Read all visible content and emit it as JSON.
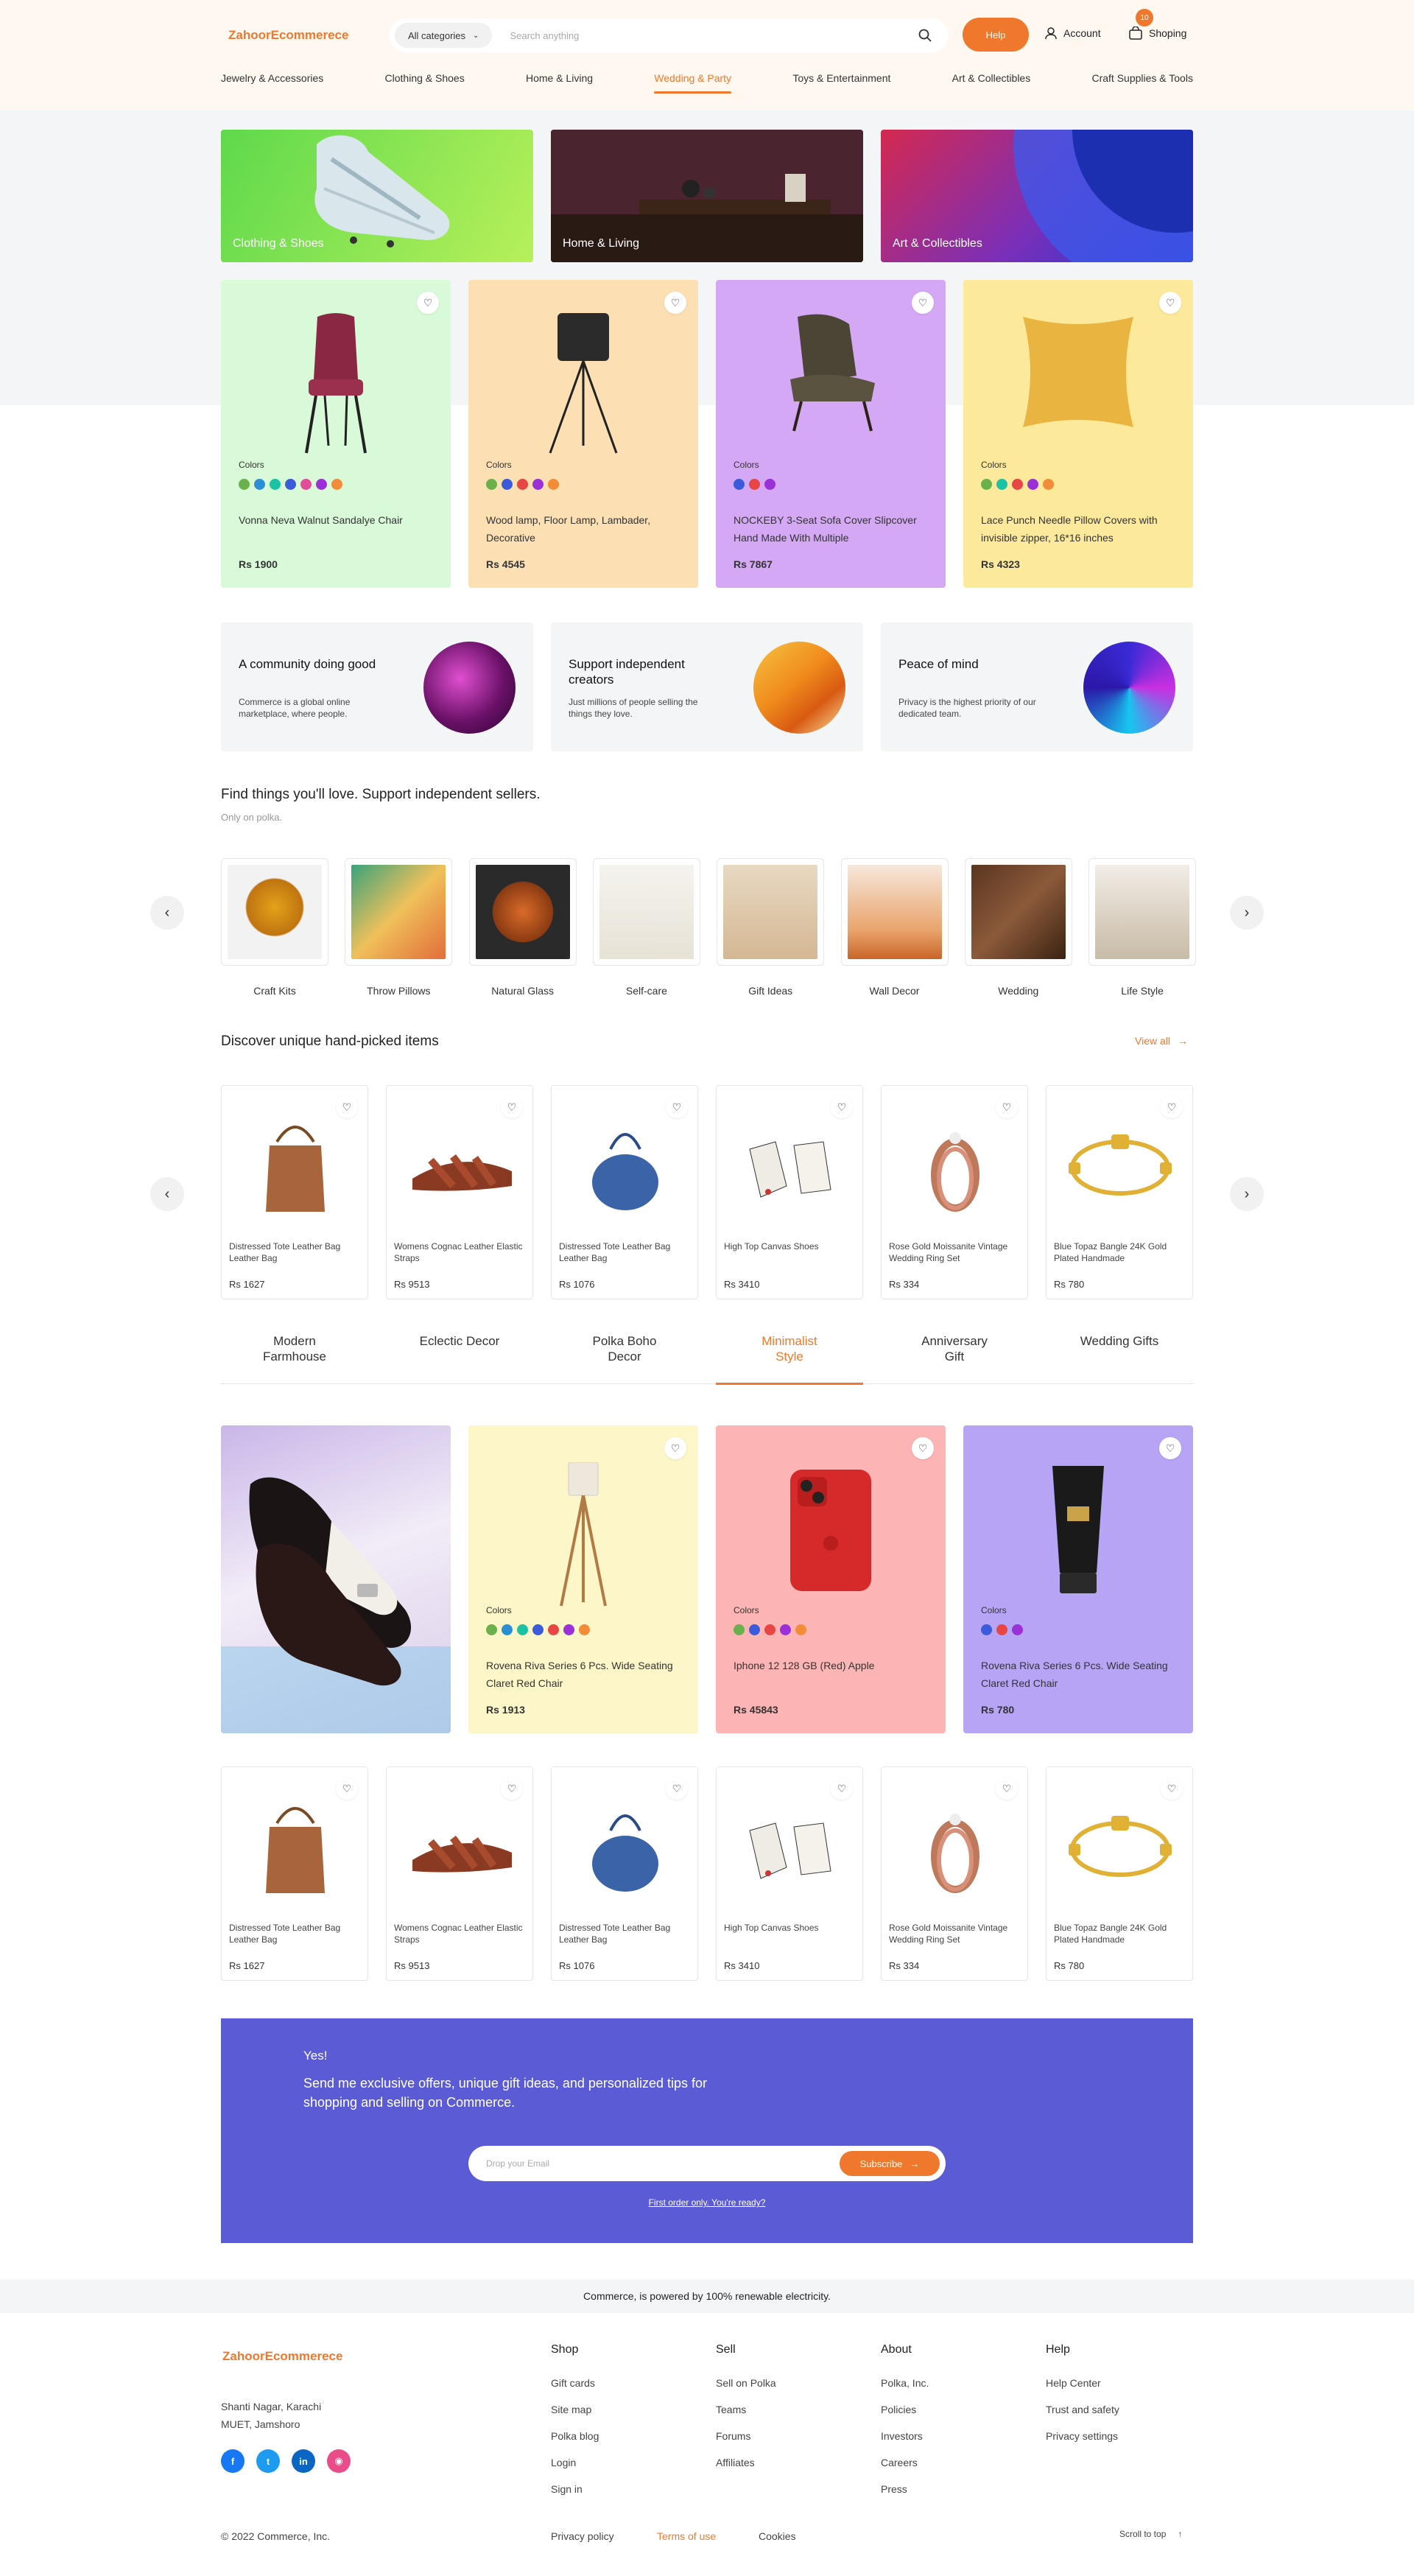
{
  "header": {
    "logo": "ZahoorEcommerece",
    "category_select": "All categories",
    "search_placeholder": "Search anything",
    "help": "Help",
    "account": "Account",
    "cart": "Shoping",
    "cart_count": "10"
  },
  "nav": [
    "Jewelry & Accessories",
    "Clothing & Shoes",
    "Home & Living",
    "Wedding & Party",
    "Toys & Entertainment",
    "Art & Collectibles",
    "Craft Supplies & Tools"
  ],
  "nav_active": "Wedding & Party",
  "banners": [
    "Clothing & Shoes",
    "Home & Living",
    "Art & Collectibles"
  ],
  "featured": {
    "colors_label": "Colors",
    "items": [
      {
        "name": "Vonna Neva Walnut Sandalye Chair",
        "price": "Rs 1900",
        "bg": "#d8fad8",
        "colors": [
          "#6ab04c",
          "#2c8fd6",
          "#1bc2a3",
          "#3b5bdb",
          "#e04e9a",
          "#9b30d9",
          "#f28c38"
        ]
      },
      {
        "name": "Wood lamp, Floor Lamp, Lambader, Decorative",
        "price": "Rs 4545",
        "bg": "#fddfb4",
        "colors": [
          "#6ab04c",
          "#3b5bdb",
          "#e84545",
          "#9b30d9",
          "#f28c38"
        ]
      },
      {
        "name": "NOCKEBY 3-Seat Sofa Cover Slipcover Hand Made With Multiple",
        "price": "Rs 7867",
        "bg": "#d4a8f5",
        "colors": [
          "#3b5bdb",
          "#e84545",
          "#9b30d9"
        ]
      },
      {
        "name": "Lace Punch Needle Pillow Covers with invisible zipper, 16*16 inches",
        "price": "Rs 4323",
        "bg": "#fde99b",
        "colors": [
          "#6ab04c",
          "#1bc2a3",
          "#e84545",
          "#9b30d9",
          "#f28c38"
        ]
      }
    ]
  },
  "info_cards": [
    {
      "title": "A community doing good",
      "desc": "Commerce is a global online marketplace, where people."
    },
    {
      "title": "Support independent creators",
      "desc": "Just millions of people selling the things they love."
    },
    {
      "title": "Peace of mind",
      "desc": "Privacy is the highest priority of our dedicated team."
    }
  ],
  "categories_section": {
    "title": "Find things you'll love. Support independent sellers.",
    "subtitle": "Only on polka.",
    "items": [
      "Craft Kits",
      "Throw Pillows",
      "Natural Glass",
      "Self-care",
      "Gift Ideas",
      "Wall Decor",
      "Wedding",
      "Life Style"
    ]
  },
  "handpicked": {
    "title": "Discover unique hand-picked items",
    "view_all": "View all",
    "items": [
      {
        "name": "Distressed Tote Leather Bag Leather Bag",
        "price": "Rs 1627"
      },
      {
        "name": "Womens Cognac Leather Elastic Straps",
        "price": "Rs 9513"
      },
      {
        "name": "Distressed Tote Leather Bag Leather Bag",
        "price": "Rs 1076"
      },
      {
        "name": "High Top Canvas Shoes",
        "price": "Rs 3410"
      },
      {
        "name": "Rose Gold Moissanite Vintage Wedding Ring Set",
        "price": "Rs 334"
      },
      {
        "name": "Blue Topaz Bangle 24K Gold Plated Handmade",
        "price": "Rs 780"
      }
    ]
  },
  "style_tabs": [
    "Modern Farmhouse",
    "Eclectic Decor",
    "Polka Boho Decor",
    "Minimalist Style",
    "Anniversary Gift",
    "Wedding Gifts"
  ],
  "style_tab_active": "Minimalist Style",
  "style_products": [
    {
      "name": "Rovena Riva Series 6 Pcs. Wide Seating Claret Red Chair",
      "price": "Rs 1913",
      "bg": "#fdf6c9",
      "colors": [
        "#6ab04c",
        "#2c8fd6",
        "#1bc2a3",
        "#3b5bdb",
        "#e84545",
        "#9b30d9",
        "#f28c38"
      ]
    },
    {
      "name": "Iphone 12 128 GB (Red) Apple",
      "price": "Rs 45843",
      "bg": "#fdb4b4",
      "colors": [
        "#6ab04c",
        "#3b5bdb",
        "#e84545",
        "#9b30d9",
        "#f28c38"
      ]
    },
    {
      "name": "Rovena Riva Series 6 Pcs. Wide Seating Claret Red Chair",
      "price": "Rs 780",
      "bg": "#b8a4f5",
      "colors": [
        "#3b5bdb",
        "#e84545",
        "#9b30d9"
      ]
    }
  ],
  "promo": {
    "title": "Yes!",
    "text": "Send me exclusive offers, unique gift ideas, and personalized tips for shopping and selling on Commerce.",
    "email_placeholder": "Drop your Email",
    "subscribe": "Subscribe",
    "note": "First order only. You're ready?"
  },
  "eco_bar": "Commerce, is powered by 100% renewable electricity.",
  "footer": {
    "logo": "ZahoorEcommerece",
    "address1": "Shanti Nagar, Karachi",
    "address2": "MUET, Jamshoro",
    "columns": [
      {
        "title": "Shop",
        "links": [
          "Gift cards",
          "Site map",
          "Polka blog",
          "Login",
          "Sign in"
        ]
      },
      {
        "title": "Sell",
        "links": [
          "Sell on Polka",
          "Teams",
          "Forums",
          "Affiliates"
        ]
      },
      {
        "title": "About",
        "links": [
          "Polka, Inc.",
          "Policies",
          "Investors",
          "Careers",
          "Press"
        ]
      },
      {
        "title": "Help",
        "links": [
          "Help Center",
          "Trust and safety",
          "Privacy settings"
        ]
      }
    ],
    "copyright": "© 2022 Commerce, Inc.",
    "privacy": "Privacy policy",
    "terms": "Terms of use",
    "cookies": "Cookies",
    "scroll_top": "Scroll to top",
    "social": [
      "facebook-icon",
      "twitter-icon",
      "linkedin-icon",
      "dribbble-icon"
    ]
  }
}
